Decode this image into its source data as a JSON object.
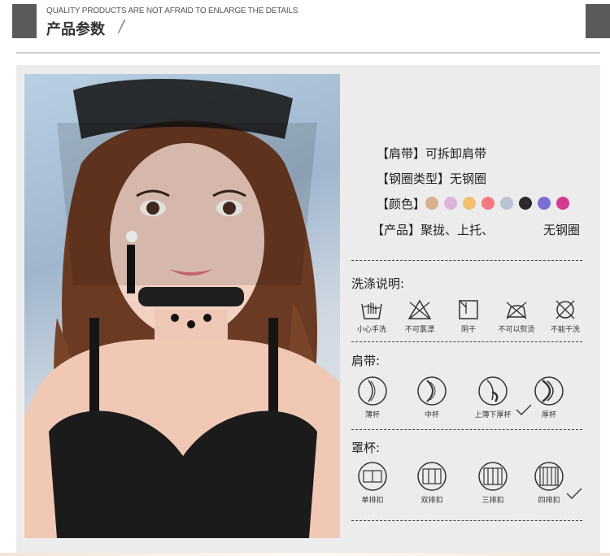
{
  "header": {
    "subtitle": "QUALITY PRODUCTS ARE NOT AFRAID TO ENLARGE THE DETAILS",
    "title": "产品参数",
    "slash": "/"
  },
  "specs": {
    "strap": "【肩带】可拆卸肩带",
    "wire": "【钢圈类型】无钢圈",
    "color_label": "【颜色】",
    "product_label": "【产品】聚拢、上托、",
    "product_extra": "无钢圈"
  },
  "colors": [
    "#d9b08c",
    "#dcb4dc",
    "#f2c070",
    "#f07a80",
    "#b9c2d4",
    "#2b2b2b",
    "#7a6fd4",
    "#d63a8f"
  ],
  "care": {
    "title": "洗涤说明:",
    "items": [
      "小心手洗",
      "不可氯漂",
      "阴干",
      "不可以熨烫",
      "不能干洗"
    ]
  },
  "strap_section": {
    "title": "肩带:",
    "items": [
      "薄杯",
      "中杯",
      "上薄下厚杯",
      "厚杯"
    ]
  },
  "cup_section": {
    "title": "罩杯:",
    "items": [
      "单排扣",
      "双排扣",
      "三排扣",
      "四排扣"
    ]
  }
}
